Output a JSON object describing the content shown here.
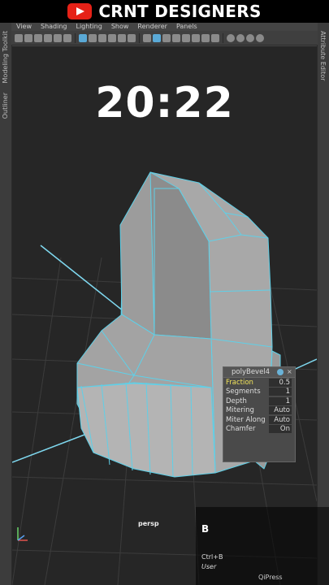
{
  "banner": {
    "title": "CRNT DESIGNERS",
    "icon": "youtube-logo-icon",
    "brand_color": "#e62117"
  },
  "menu": [
    "View",
    "Shading",
    "Lighting",
    "Show",
    "Renderer",
    "Panels"
  ],
  "left_tabs": {
    "modeling_toolkit": "Modeling Toolkit",
    "outliner": "Outliner"
  },
  "right_tabs": {
    "attribute_editor": "Attribute Editor"
  },
  "timer": "20:22",
  "poly_bevel": {
    "title": "polyBevel4",
    "rows": [
      {
        "label": "Fraction",
        "value": "0.5"
      },
      {
        "label": "Segments",
        "value": "1"
      },
      {
        "label": "Depth",
        "value": "1"
      },
      {
        "label": "Mitering",
        "value": "Auto"
      },
      {
        "label": "Miter Along",
        "value": "Auto"
      },
      {
        "label": "Chamfer",
        "value": "On"
      }
    ]
  },
  "viewport": {
    "camera": "persp",
    "wire_color": "#5fd0e8",
    "grid_axis_color": "#7fd8ef"
  },
  "key_overlay": {
    "key": "B",
    "shortcut": "Ctrl+B",
    "user": "User",
    "brand": "QiPress"
  }
}
